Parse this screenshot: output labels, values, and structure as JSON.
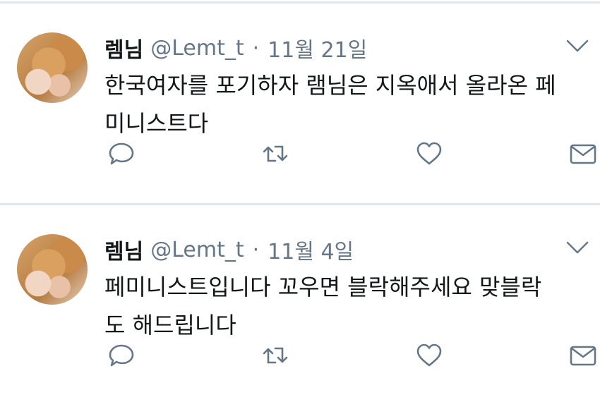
{
  "tweets": [
    {
      "name": "렘님",
      "handle": "@Lemt_t",
      "separator": "·",
      "date": "11월 21일",
      "line1": "한국여자를 포기하자 램님은 지옥애서 올라온 페",
      "line2": "미니스트다"
    },
    {
      "name": "렘님",
      "handle": "@Lemt_t",
      "separator": "·",
      "date": "11월 4일",
      "line1": "페미니스트입니다 꼬우면 블락해주세요 맞블락",
      "line2": "도 해드립니다"
    }
  ],
  "icons": {
    "reply": "speech-bubble",
    "retweet": "retweet-arrows",
    "like": "heart",
    "message": "envelope",
    "menu": "chevron-down"
  },
  "colors": {
    "icon": "#657786",
    "separator": "#e1e8ed",
    "text": "#14171a"
  }
}
